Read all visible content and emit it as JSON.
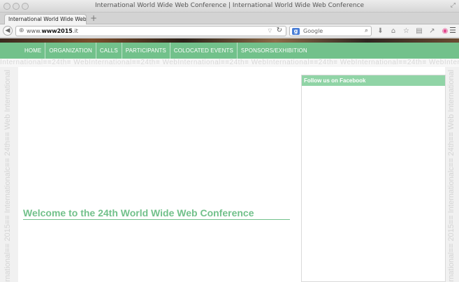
{
  "window": {
    "title": "International World Wide Web Conference | International World Wide Web Conference"
  },
  "tabs": [
    {
      "label": "International World Wide Web ..."
    }
  ],
  "address": {
    "prefix": "www.",
    "domain": "www2015",
    "suffix": ".it"
  },
  "search": {
    "placeholder": "Google"
  },
  "site": {
    "menu": [
      {
        "label": "HOME"
      },
      {
        "label": "ORGANIZATION"
      },
      {
        "label": "CALLS"
      },
      {
        "label": "PARTICIPANTS"
      },
      {
        "label": "COLOCATED EVENTS"
      },
      {
        "label": "SPONSORS/EXHIBITION"
      }
    ],
    "pattern_text": "International≡≡24th≡ WebInternational≡≡24th≡ WebInternational≡≡24th≡ WebInternational≡≡24th≡ WebInternational≡≡24th≡ WebInternational",
    "side_text": "International≡≡ 2015≡≡ Internationalc≡≡ 24th≡≡ Web International",
    "welcome_title": "Welcome to the 24th World Wide Web Conference",
    "facebook_header": "Follow us on Facebook"
  },
  "colors": {
    "brand_green": "#72c18b",
    "facebook_header": "#90d4a6"
  }
}
